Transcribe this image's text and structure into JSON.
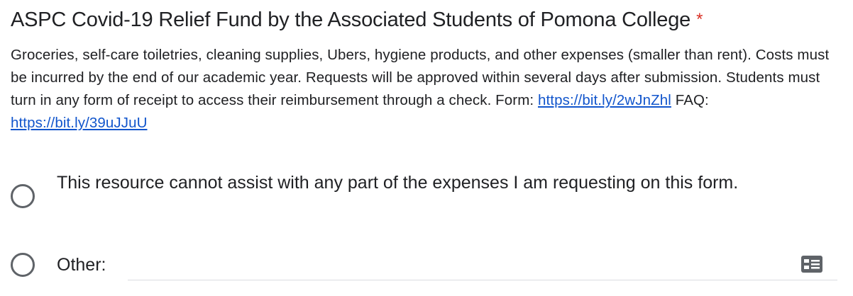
{
  "question": {
    "title": "ASPC Covid-19 Relief Fund by the Associated Students of Pomona College",
    "required_marker": "*",
    "description_text": "Groceries, self-care toiletries, cleaning supplies, Ubers, hygiene products, and other expenses (smaller than rent). Costs must be incurred by the end of our academic year. Requests will be approved within several days after submission. Students must turn in any form of receipt to access their reimbursement through a check. Form:",
    "form_link": "https://bit.ly/2wJnZhl",
    "faq_label": "FAQ:",
    "faq_link": "https://bit.ly/39uJJuU"
  },
  "options": [
    {
      "label": "This resource cannot assist with any part of the expenses I am requesting on this form.",
      "selected": false
    },
    {
      "label": "Other:",
      "selected": false,
      "input_value": ""
    }
  ],
  "icons": {
    "other_input_icon": "text-field-icon"
  },
  "colors": {
    "required": "#d93025",
    "link": "#1155cc",
    "radio_border": "#5f6368",
    "input_underline": "#dadce0",
    "icon": "#5f6368"
  }
}
